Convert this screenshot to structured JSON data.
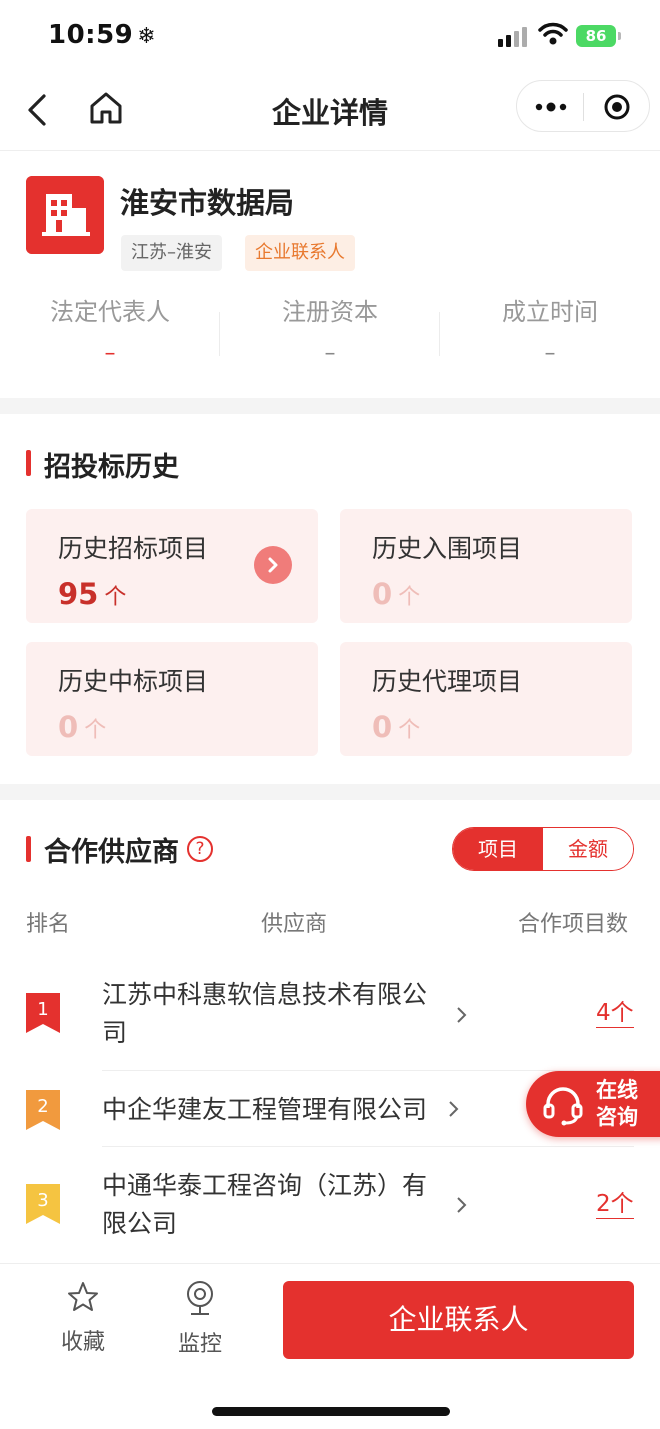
{
  "status_bar": {
    "time": "10:59",
    "time_icon": "❄",
    "battery": "86"
  },
  "nav": {
    "title": "企业详情"
  },
  "company": {
    "name": "淮安市数据局",
    "tags": [
      "江苏–淮安",
      "企业联系人"
    ],
    "info": [
      {
        "label": "法定代表人",
        "value": "–"
      },
      {
        "label": "注册资本",
        "value": "–"
      },
      {
        "label": "成立时间",
        "value": "–"
      }
    ]
  },
  "bidding": {
    "title": "招投标历史",
    "cards": [
      {
        "label": "历史招标项目",
        "value": "95",
        "unit": "个"
      },
      {
        "label": "历史入围项目",
        "value": "0",
        "unit": "个"
      },
      {
        "label": "历史中标项目",
        "value": "0",
        "unit": "个"
      },
      {
        "label": "历史代理项目",
        "value": "0",
        "unit": "个"
      }
    ]
  },
  "suppliers": {
    "title": "合作供应商",
    "help_icon": "?",
    "toggle": [
      "项目",
      "金额"
    ],
    "headers": [
      "排名",
      "供应商",
      "合作项目数"
    ],
    "rows": [
      {
        "rank": "1",
        "name": "江苏中科惠软信息技术有限公司",
        "count": "4个"
      },
      {
        "rank": "2",
        "name": "中企华建友工程管理有限公司",
        "count": ""
      },
      {
        "rank": "3",
        "name": "中通华泰工程咨询（江苏）有限公司",
        "count": "2个"
      }
    ]
  },
  "consult": {
    "line1": "在线",
    "line2": "咨询"
  },
  "bottom": {
    "favorite": "收藏",
    "monitor": "监控",
    "cta": "企业联系人"
  },
  "colors": {
    "accent": "#e4312e",
    "card_bg": "#fdf0ef",
    "tag_orange": "#e8792f",
    "rank2": "#f19a3e",
    "rank3": "#f5c441"
  }
}
